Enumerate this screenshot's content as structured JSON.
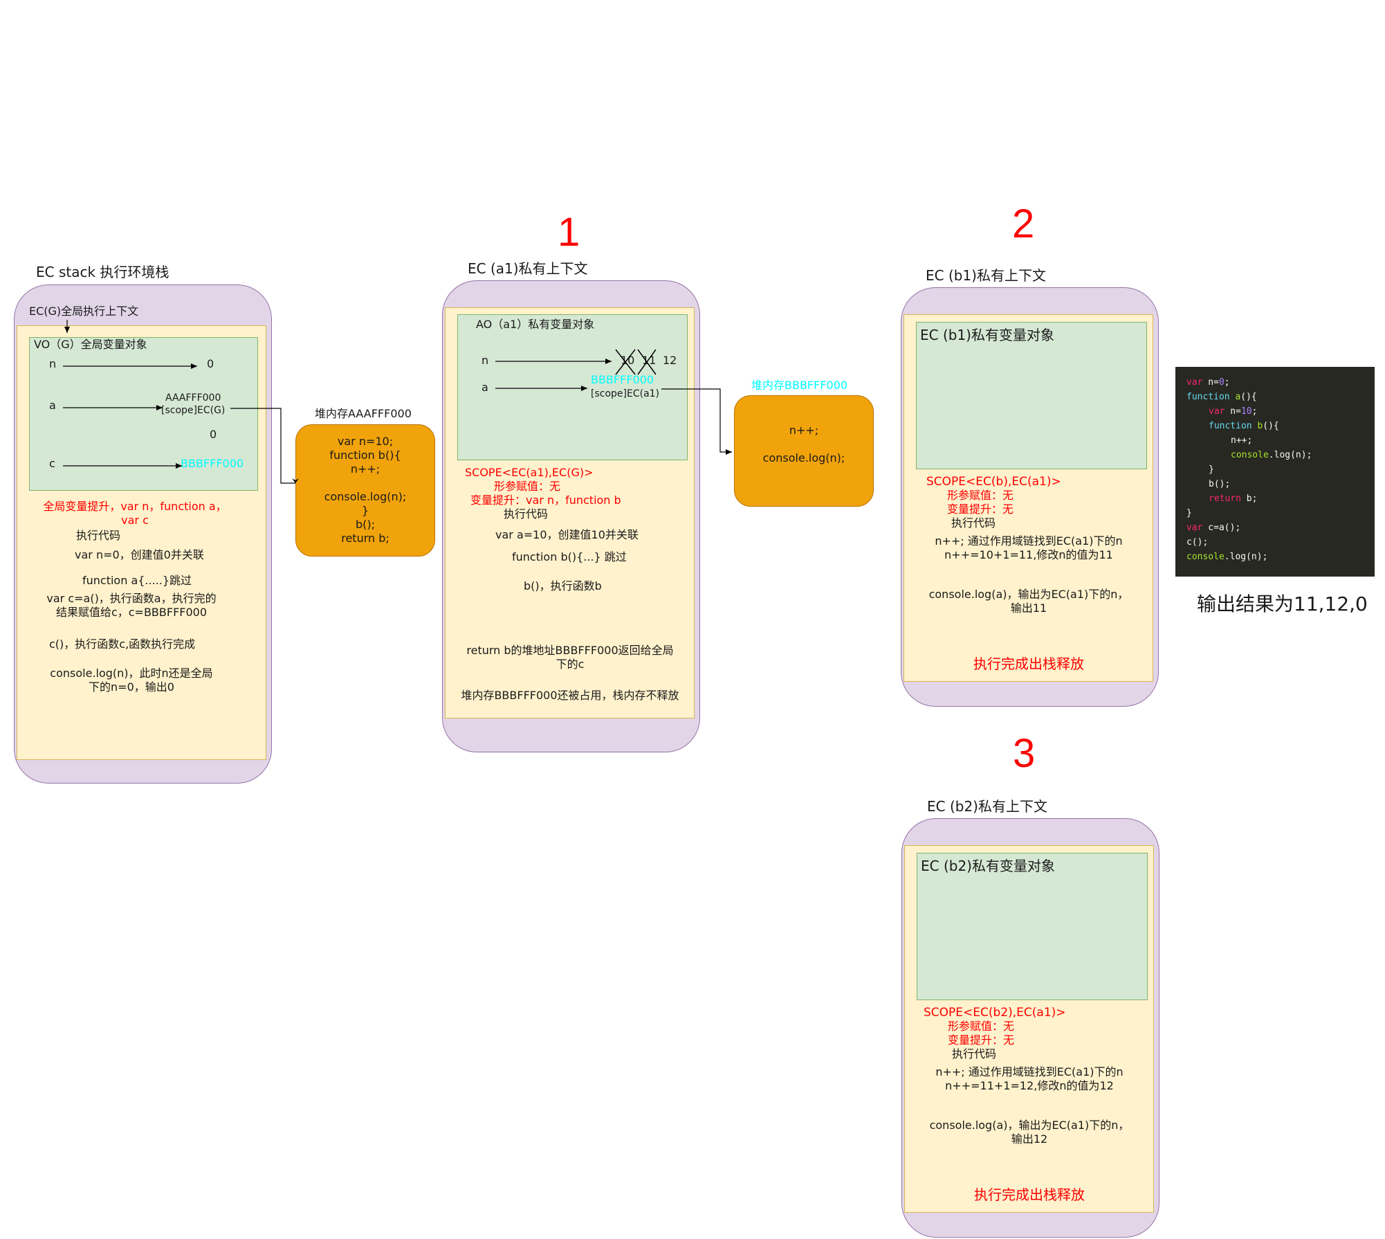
{
  "step_numbers": {
    "one": "1",
    "two": "2",
    "three": "3"
  },
  "ec_stack": {
    "title": "EC stack  执行环境栈",
    "global_ec_label": "EC(G)全局执行上下文",
    "vo_label": "VO（G）全局变量对象",
    "var_n": "n",
    "var_n_value": "0",
    "var_a": "a",
    "var_a_value_line1": "AAAFFF000",
    "var_a_value_line2": "[scope]EC(G)",
    "var_a_extra_value": "0",
    "var_c": "c",
    "var_c_value": "BBBFFF000",
    "hoist_line1": "全局变量提升，var n，function a，",
    "hoist_line2": "var c",
    "exec_label": "执行代码",
    "step_n": "var n=0，创建值0并关联",
    "step_func_a": "function a{.....}跳过",
    "step_c_line1": "var c=a()，执行函数a，执行完的",
    "step_c_line2": "结果赋值给c，c=BBBFFF000",
    "step_call_c": "c()，执行函数c,函数执行完成",
    "step_log_line1": "console.log(n)，此时n还是全局",
    "step_log_line2": "下的n=0，输出0"
  },
  "heap_aaa": {
    "label": "堆内存AAAFFF000",
    "lines": [
      "var n=10;",
      "function b(){",
      "n++;",
      "",
      "console.log(n);",
      "}",
      "b();",
      "return b;"
    ]
  },
  "ec_a1": {
    "title": "EC (a1)私有上下文",
    "ao_label": "AO（a1）私有变量对象",
    "var_n": "n",
    "n_old1": "10",
    "n_old2": "11",
    "n_value": "12",
    "var_a": "a",
    "a_value": "BBBFFF000",
    "a_scope": "[scope]EC(a1)",
    "scope_chain": "SCOPE<EC(a1),EC(G)>",
    "params": "形参赋值：无",
    "hoist": "变量提升：var n，function b",
    "exec_label": "执行代码",
    "step_a": "var a=10，创建值10并关联",
    "step_func_b": "function b(){...}  跳过",
    "step_call_b": "b()，执行函数b",
    "step_return_line1": "return b的堆地址BBBFFF000返回给全局",
    "step_return_line2": "下的c",
    "step_heap_note": "堆内存BBBFFF000还被占用，栈内存不释放"
  },
  "heap_bbb": {
    "label": "堆内存BBBFFF000",
    "line1": "n++;",
    "line2": "console.log(n);"
  },
  "ec_b1": {
    "title": "EC (b1)私有上下文",
    "vo_label": "EC (b1)私有变量对象",
    "scope_chain": "SCOPE<EC(b),EC(a1)>",
    "params": "形参赋值：无",
    "hoist": "变量提升：无",
    "exec_label": "执行代码",
    "step_inc_line1": "n++; 通过作用域链找到EC(a1)下的n",
    "step_inc_line2": "n++=10+1=11,修改n的值为11",
    "step_log_line1": "console.log(a)，输出为EC(a1)下的n，",
    "step_log_line2": "输出11",
    "release": "执行完成出栈释放"
  },
  "ec_b2": {
    "title": "EC (b2)私有上下文",
    "vo_label": "EC (b2)私有变量对象",
    "scope_chain": "SCOPE<EC(b2),EC(a1)>",
    "params": "形参赋值：无",
    "hoist": "变量提升：无",
    "exec_label": "执行代码",
    "step_inc_line1": "n++; 通过作用域链找到EC(a1)下的n",
    "step_inc_line2": "n++=11+1=12,修改n的值为12",
    "step_log_line1": "console.log(a)，输出为EC(a1)下的n，",
    "step_log_line2": "输出12",
    "release": "执行完成出栈释放"
  },
  "code_snippet": {
    "l1": {
      "kw": "var",
      "rest": " n=",
      "num": "0",
      "end": ";"
    },
    "l2": {
      "kw": "function",
      "name": " a",
      "rest": "(){"
    },
    "l3": {
      "kw": "var",
      "rest": " n=",
      "num": "10",
      "end": ";"
    },
    "l4": {
      "kw": "function",
      "name": " b",
      "rest": "(){"
    },
    "l5": "n++;",
    "l6": {
      "obj": "console",
      "rest": ".log(n);"
    },
    "l7": "}",
    "l8": "b();",
    "l9": {
      "kw": "return",
      "rest": " b;"
    },
    "l10": "}",
    "l11": {
      "kw": "var",
      "rest": " c=a();"
    },
    "l12": "c();",
    "l13": {
      "obj": "console",
      "rest": ".log(n);"
    }
  },
  "output_result": "输出结果为11,12,0",
  "colors": {
    "red": "#ff0000",
    "cyan": "#00ffff",
    "phone": "#e1d5e7",
    "inner": "#fff2cc",
    "green": "#d5e8d4",
    "heap": "#f0a30a",
    "code_bg": "#272822"
  }
}
